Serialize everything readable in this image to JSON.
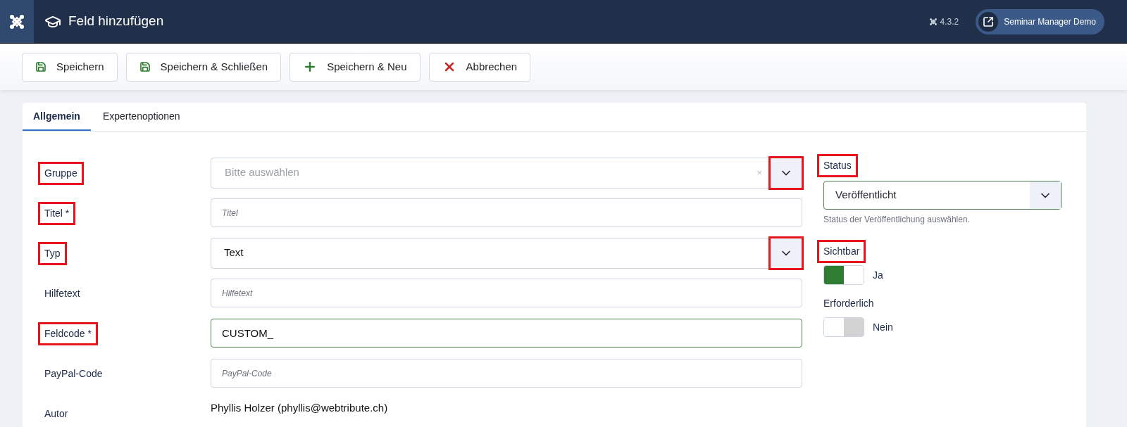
{
  "header": {
    "title": "Feld hinzufügen",
    "version": "4.3.2",
    "site_button": "Seminar Manager Demo"
  },
  "toolbar": [
    {
      "label": "Speichern",
      "kind": "save"
    },
    {
      "label": "Speichern & Schließen",
      "kind": "save"
    },
    {
      "label": "Speichern & Neu",
      "kind": "new"
    },
    {
      "label": "Abbrechen",
      "kind": "cancel"
    }
  ],
  "tabs": [
    {
      "label": "Allgemein",
      "selected": true
    },
    {
      "label": "Expertenoptionen",
      "selected": false
    }
  ],
  "fields": [
    {
      "label": "Gruppe",
      "highlighted": true,
      "kind": "select",
      "placeholder": "Bitte auswählen",
      "clear": "×",
      "button_highlighted": true
    },
    {
      "label": "Titel *",
      "highlighted": true,
      "kind": "text",
      "placeholder": "Titel"
    },
    {
      "label": "Typ",
      "highlighted": true,
      "kind": "select",
      "value": "Text",
      "button_highlighted": true
    },
    {
      "label": "Hilfetext",
      "highlighted": false,
      "kind": "text",
      "placeholder": "Hilfetext"
    },
    {
      "label": "Feldcode *",
      "highlighted": true,
      "kind": "text",
      "value": "CUSTOM_",
      "valid": true
    },
    {
      "label": "PayPal-Code",
      "highlighted": false,
      "kind": "text",
      "placeholder": "PayPal-Code"
    },
    {
      "label": "Autor",
      "highlighted": false,
      "kind": "info",
      "value": "Phyllis Holzer (phyllis@webtribute.ch)"
    }
  ],
  "side": {
    "status": {
      "label": "Status",
      "highlighted": true,
      "value": "Veröffentlicht",
      "valid": true,
      "hint": "Status der Veröffentlichung auswählen."
    },
    "toggles": [
      {
        "label": "Sichtbar",
        "highlighted": true,
        "on": true,
        "state_text": "Ja"
      },
      {
        "label": "Erforderlich",
        "highlighted": false,
        "on": false,
        "state_text": "Nein"
      }
    ]
  }
}
